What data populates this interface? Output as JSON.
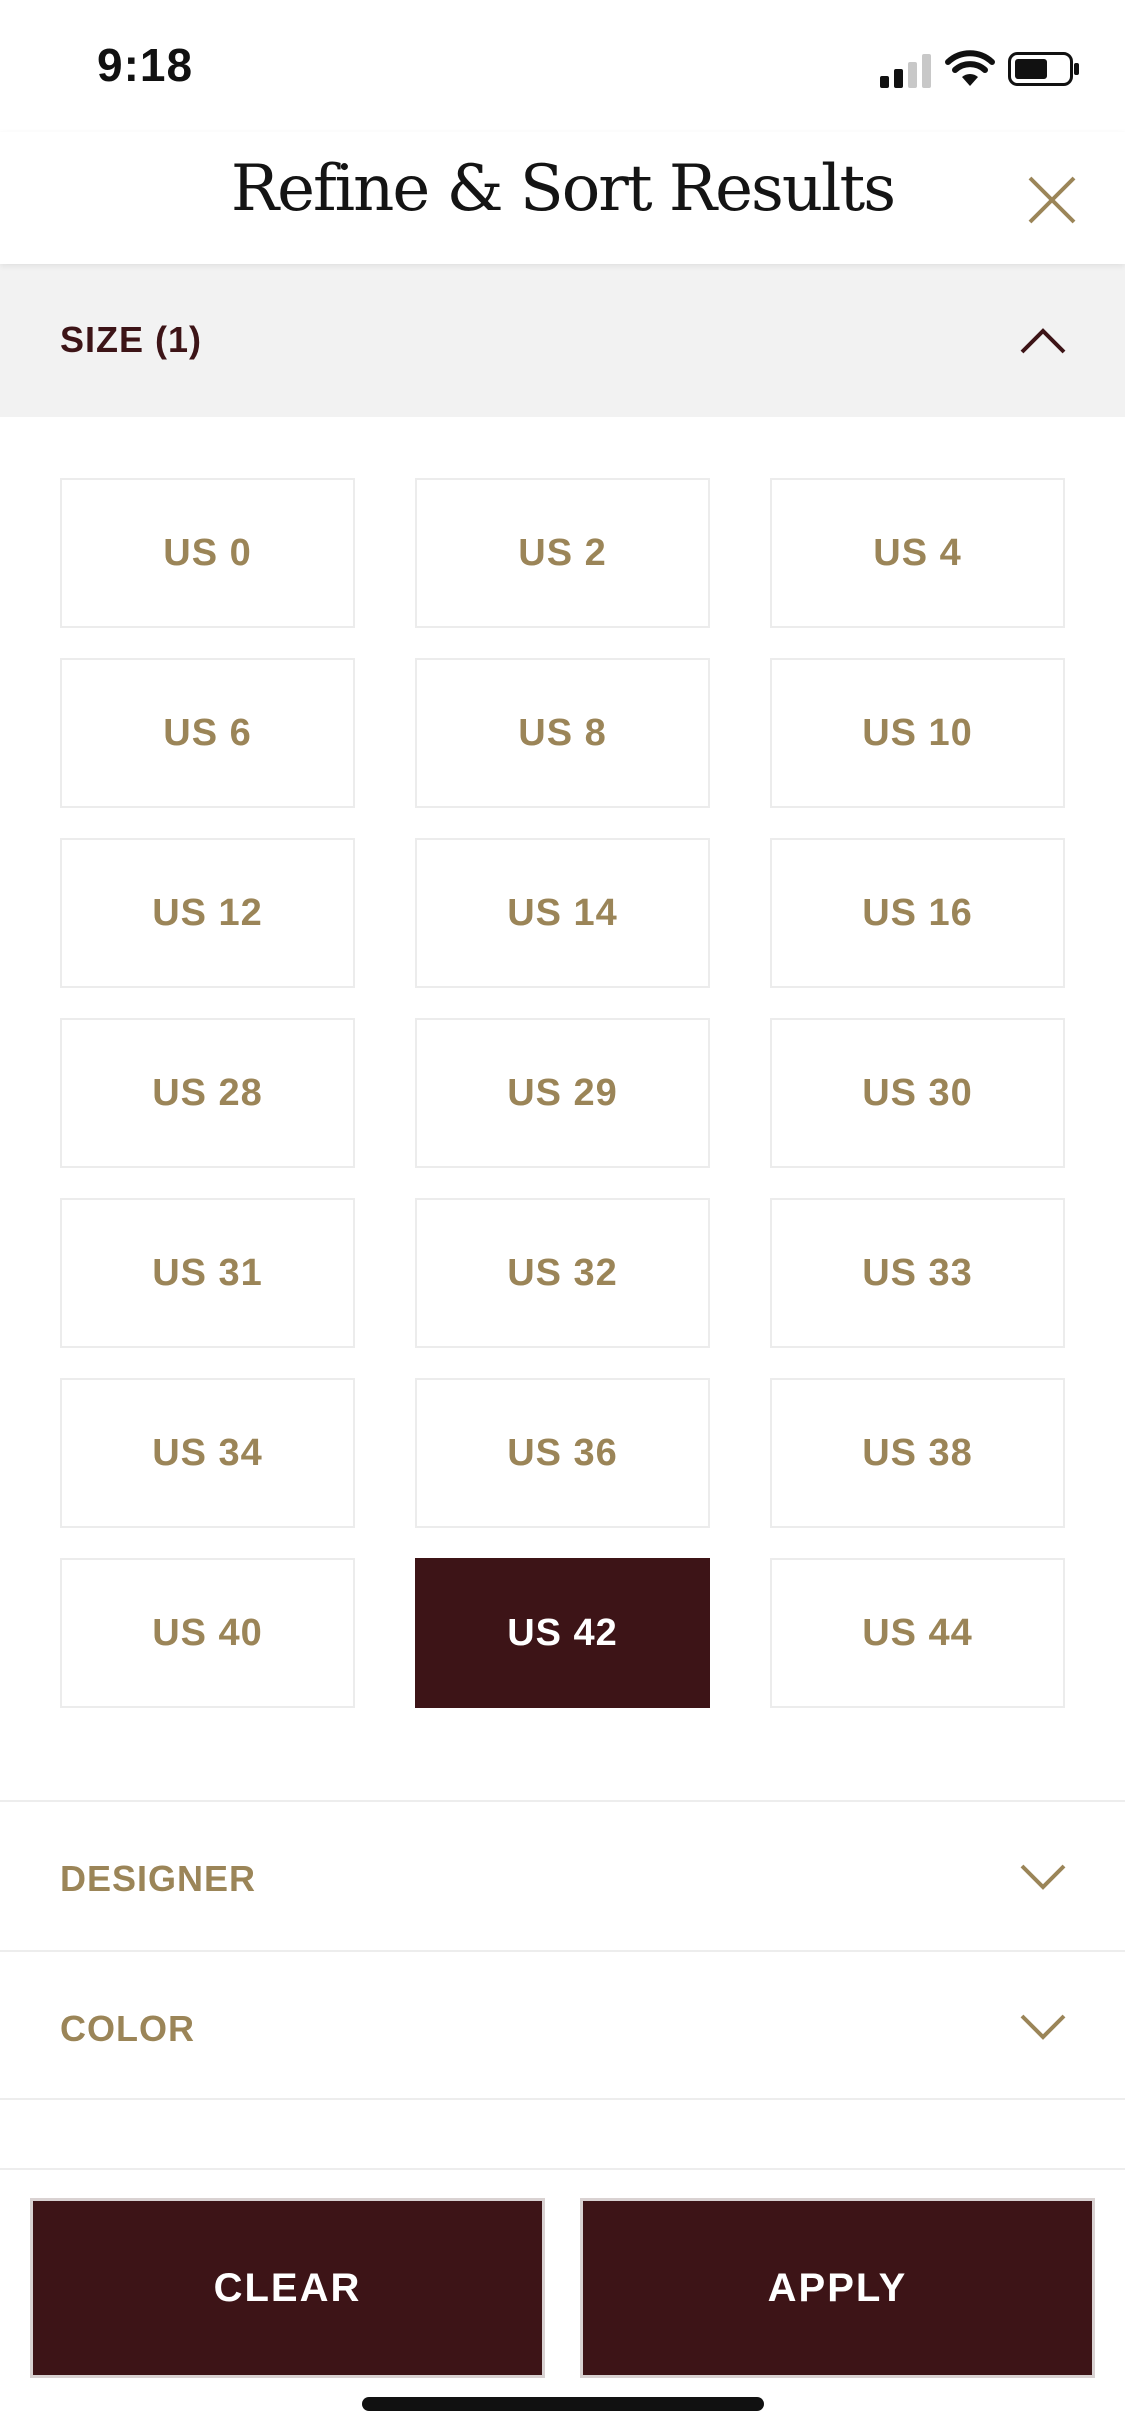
{
  "status_bar": {
    "time": "9:18",
    "icons": [
      "cellular-signal-icon",
      "wifi-icon",
      "battery-icon"
    ]
  },
  "header": {
    "title": "Refine & Sort Results",
    "close_icon": "close-icon"
  },
  "sections": {
    "size": {
      "title": "SIZE (1)",
      "expanded": true,
      "chevron_icon": "chevron-up-icon",
      "options": [
        {
          "label": "US 0",
          "selected": false
        },
        {
          "label": "US 2",
          "selected": false
        },
        {
          "label": "US 4",
          "selected": false
        },
        {
          "label": "US 6",
          "selected": false
        },
        {
          "label": "US 8",
          "selected": false
        },
        {
          "label": "US 10",
          "selected": false
        },
        {
          "label": "US 12",
          "selected": false
        },
        {
          "label": "US 14",
          "selected": false
        },
        {
          "label": "US 16",
          "selected": false
        },
        {
          "label": "US 28",
          "selected": false
        },
        {
          "label": "US 29",
          "selected": false
        },
        {
          "label": "US 30",
          "selected": false
        },
        {
          "label": "US 31",
          "selected": false
        },
        {
          "label": "US 32",
          "selected": false
        },
        {
          "label": "US 33",
          "selected": false
        },
        {
          "label": "US 34",
          "selected": false
        },
        {
          "label": "US 36",
          "selected": false
        },
        {
          "label": "US 38",
          "selected": false
        },
        {
          "label": "US 40",
          "selected": false
        },
        {
          "label": "US 42",
          "selected": true
        },
        {
          "label": "US 44",
          "selected": false
        }
      ]
    },
    "designer": {
      "title": "DESIGNER",
      "expanded": false,
      "chevron_icon": "chevron-down-icon"
    },
    "color": {
      "title": "COLOR",
      "expanded": false,
      "chevron_icon": "chevron-down-icon"
    }
  },
  "footer": {
    "clear_label": "CLEAR",
    "apply_label": "APPLY"
  },
  "colors": {
    "brand_dark": "#3d1417",
    "accent_gold": "#9b8558",
    "section_bg": "#f2f2f2"
  }
}
